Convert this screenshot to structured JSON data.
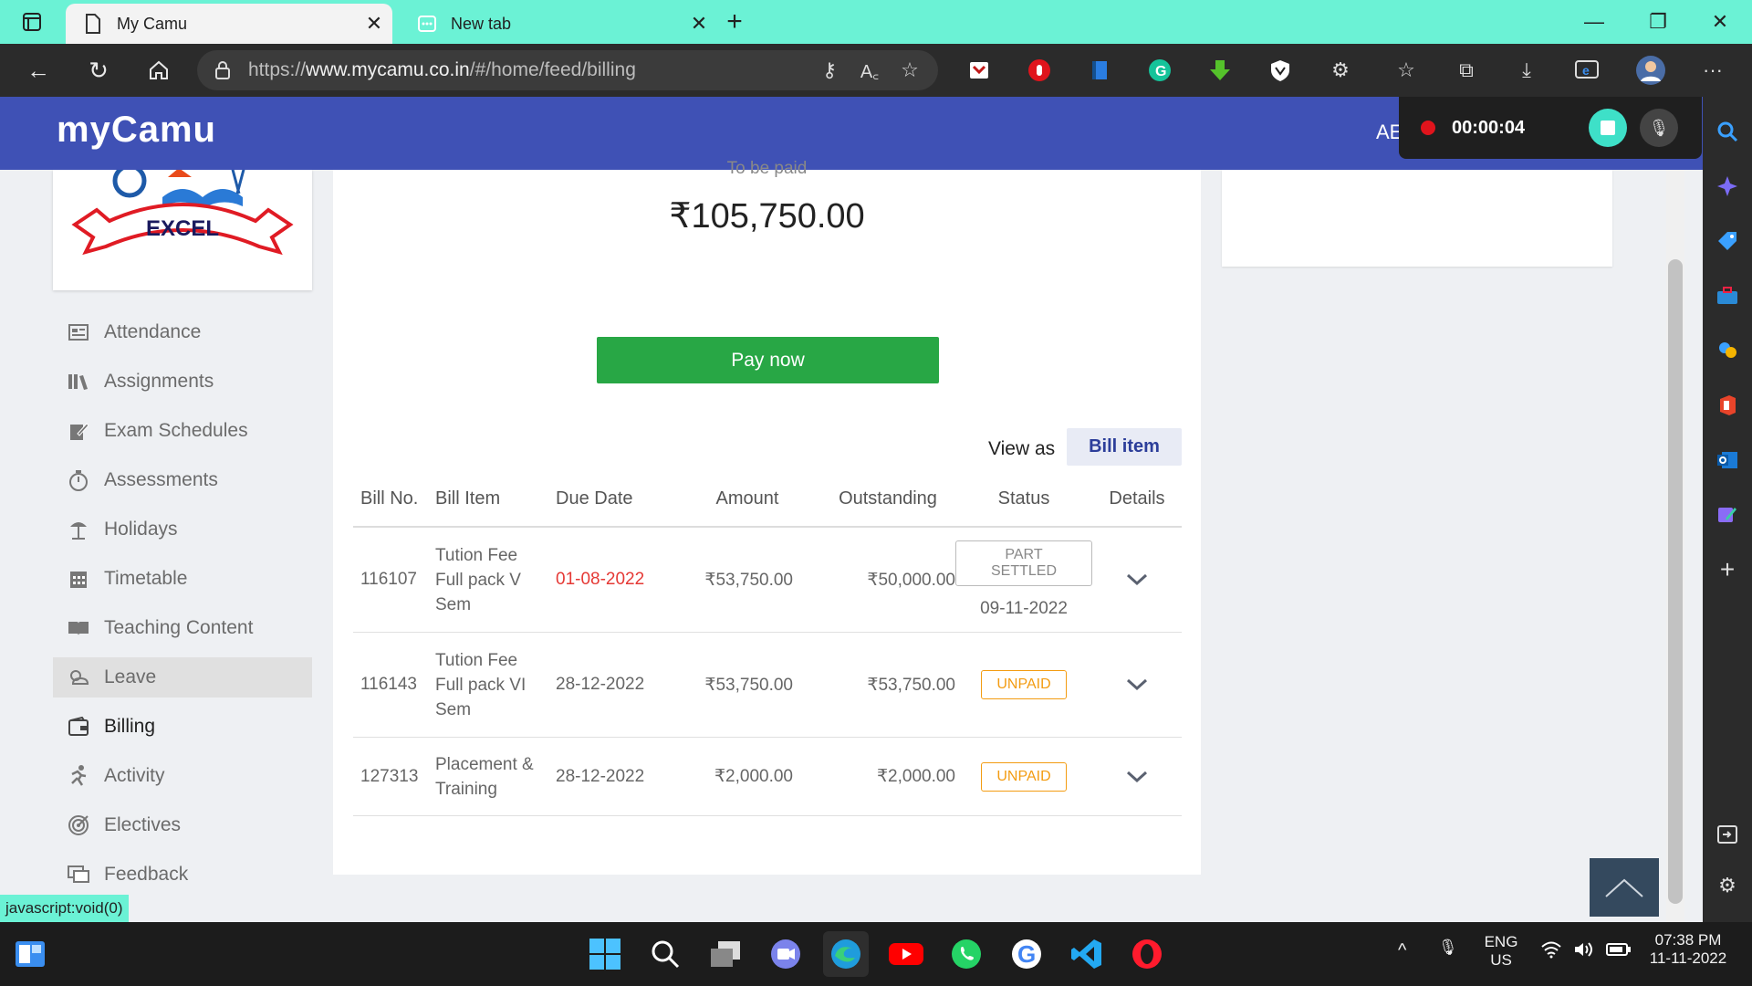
{
  "browser": {
    "tabs": [
      {
        "title": "My Camu",
        "active": true
      },
      {
        "title": "New tab",
        "active": false
      }
    ],
    "url_prefix": "https://",
    "url_domain": "www.mycamu.co.in",
    "url_path": "/#/home/feed/billing",
    "status_link": "javascript:void(0)"
  },
  "app": {
    "logo": "myCamu",
    "user_initials": "AE",
    "school_banner": "EXCEL"
  },
  "recorder": {
    "time": "00:00:04"
  },
  "sidebar": {
    "items": [
      {
        "label": "Attendance",
        "icon": "attendance-icon",
        "state": "normal"
      },
      {
        "label": "Assignments",
        "icon": "assignments-icon",
        "state": "normal"
      },
      {
        "label": "Exam Schedules",
        "icon": "exam-schedules-icon",
        "state": "normal"
      },
      {
        "label": "Assessments",
        "icon": "assessments-icon",
        "state": "normal"
      },
      {
        "label": "Holidays",
        "icon": "holidays-icon",
        "state": "normal"
      },
      {
        "label": "Timetable",
        "icon": "timetable-icon",
        "state": "normal"
      },
      {
        "label": "Teaching Content",
        "icon": "teaching-content-icon",
        "state": "normal"
      },
      {
        "label": "Leave",
        "icon": "leave-icon",
        "state": "hover"
      },
      {
        "label": "Billing",
        "icon": "billing-icon",
        "state": "active"
      },
      {
        "label": "Activity",
        "icon": "activity-icon",
        "state": "normal"
      },
      {
        "label": "Electives",
        "icon": "electives-icon",
        "state": "normal"
      },
      {
        "label": "Feedback",
        "icon": "feedback-icon",
        "state": "normal"
      }
    ]
  },
  "billing": {
    "to_be_paid_label": "To be paid",
    "total_amount": "₹105,750.00",
    "pay_button": "Pay now",
    "view_as_label": "View as",
    "view_as_value": "Bill item",
    "columns": [
      "Bill No.",
      "Bill Item",
      "Due Date",
      "Amount",
      "Outstanding",
      "Status",
      "Details"
    ],
    "rows": [
      {
        "bill_no": "116107",
        "item_lines": [
          "Tution Fee",
          "Full pack V",
          "Sem"
        ],
        "due_date": "01-08-2022",
        "overdue": true,
        "amount": "₹53,750.00",
        "outstanding": "₹50,000.00",
        "status": "PART SETTLED",
        "status_date": "09-11-2022"
      },
      {
        "bill_no": "116143",
        "item_lines": [
          "Tution Fee",
          "Full pack VI",
          "Sem"
        ],
        "due_date": "28-12-2022",
        "overdue": false,
        "amount": "₹53,750.00",
        "outstanding": "₹53,750.00",
        "status": "UNPAID",
        "status_date": ""
      },
      {
        "bill_no": "127313",
        "item_lines": [
          "Placement &",
          "Training"
        ],
        "due_date": "28-12-2022",
        "overdue": false,
        "amount": "₹2,000.00",
        "outstanding": "₹2,000.00",
        "status": "UNPAID",
        "status_date": ""
      }
    ]
  },
  "taskbar": {
    "lang": "ENG",
    "region": "US",
    "time": "07:38 PM",
    "date": "11-11-2022"
  },
  "colors": {
    "tab_bar": "#6bf2d5",
    "app_bar": "#3f51b5",
    "pay_button": "#28a745",
    "overdue": "#e53935",
    "unpaid": "#f39c12"
  }
}
